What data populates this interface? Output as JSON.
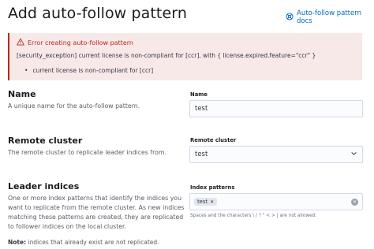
{
  "header": {
    "title": "Add auto-follow pattern",
    "docs_link": "Auto-follow pattern docs"
  },
  "error_callout": {
    "title": "Error creating auto-follow pattern",
    "message": "[security_exception] current license is non-compliant for [ccr], with { license.expired.feature=\"ccr\" }",
    "items": [
      "current license is non-compliant for [ccr]"
    ]
  },
  "name_section": {
    "title": "Name",
    "description": "A unique name for the auto-follow pattern.",
    "field_label": "Name",
    "value": "test"
  },
  "remote_section": {
    "title": "Remote cluster",
    "description": "The remote cluster to replicate leader indices from.",
    "field_label": "Remote cluster",
    "selected": "test"
  },
  "leader_section": {
    "title": "Leader indices",
    "description": "One or more index patterns that identify the indices you want to replicate from the remote cluster. As new indices matching these patterns are created, they are replicated to follower indices on the local cluster.",
    "field_label": "Index patterns",
    "patterns": [
      "test"
    ],
    "help_text": "Spaces and the characters \\ / ? \" < > | are not allowed.",
    "note_label": "Note:",
    "note_text": "indices that already exist are not replicated."
  }
}
